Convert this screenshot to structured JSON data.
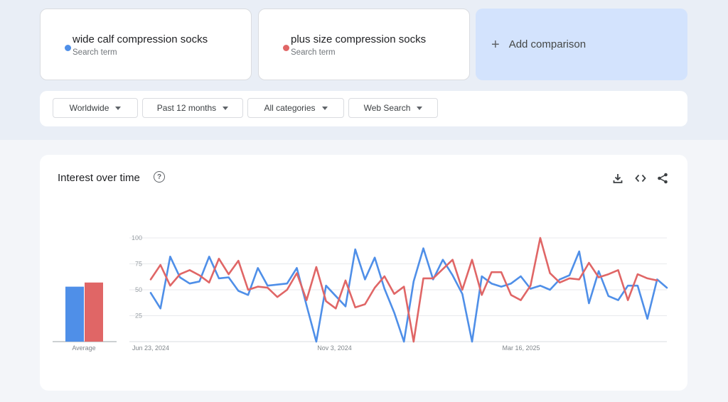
{
  "terms": [
    {
      "label": "wide calf compression socks",
      "sub": "Search term",
      "color": "#4f8fe8"
    },
    {
      "label": "plus size compression socks",
      "sub": "Search term",
      "color": "#e06666"
    }
  ],
  "add_comparison": "Add comparison",
  "filters": [
    "Worldwide",
    "Past 12 months",
    "All categories",
    "Web Search"
  ],
  "chart_header": {
    "title": "Interest over time",
    "help_icon": "help-circle-icon"
  },
  "toolbar_icons": [
    "download-icon",
    "embed-code-icon",
    "share-icon"
  ],
  "chart_data": {
    "type": "line",
    "title": "Interest over time",
    "ylim": [
      0,
      100
    ],
    "yticks": [
      25,
      50,
      75,
      100
    ],
    "x_tick_labels": [
      "Jun 23, 2024",
      "Nov 3, 2024",
      "Mar 16, 2025"
    ],
    "x_tick_index": [
      0,
      19,
      38
    ],
    "grid": true,
    "average": {
      "label": "Average",
      "values": [
        53,
        57
      ]
    },
    "series": [
      {
        "name": "wide calf compression socks",
        "color": "#4f8fe8",
        "values": [
          47,
          32,
          82,
          62,
          56,
          58,
          82,
          61,
          62,
          49,
          45,
          71,
          54,
          55,
          56,
          71,
          35,
          0,
          54,
          44,
          34,
          89,
          60,
          81,
          51,
          28,
          0,
          58,
          90,
          60,
          79,
          64,
          46,
          0,
          63,
          56,
          53,
          56,
          63,
          51,
          54,
          50,
          60,
          64,
          87,
          37,
          68,
          44,
          40,
          54,
          54,
          22,
          60,
          52
        ]
      },
      {
        "name": "plus size compression socks",
        "color": "#e06666",
        "values": [
          60,
          74,
          54,
          65,
          69,
          64,
          57,
          80,
          65,
          78,
          50,
          53,
          52,
          43,
          50,
          66,
          40,
          72,
          39,
          32,
          59,
          33,
          36,
          52,
          63,
          46,
          53,
          0,
          61,
          61,
          70,
          79,
          50,
          79,
          45,
          67,
          67,
          45,
          40,
          54,
          100,
          66,
          57,
          61,
          60,
          76,
          62,
          65,
          69,
          40,
          65,
          61,
          59
        ]
      }
    ]
  }
}
